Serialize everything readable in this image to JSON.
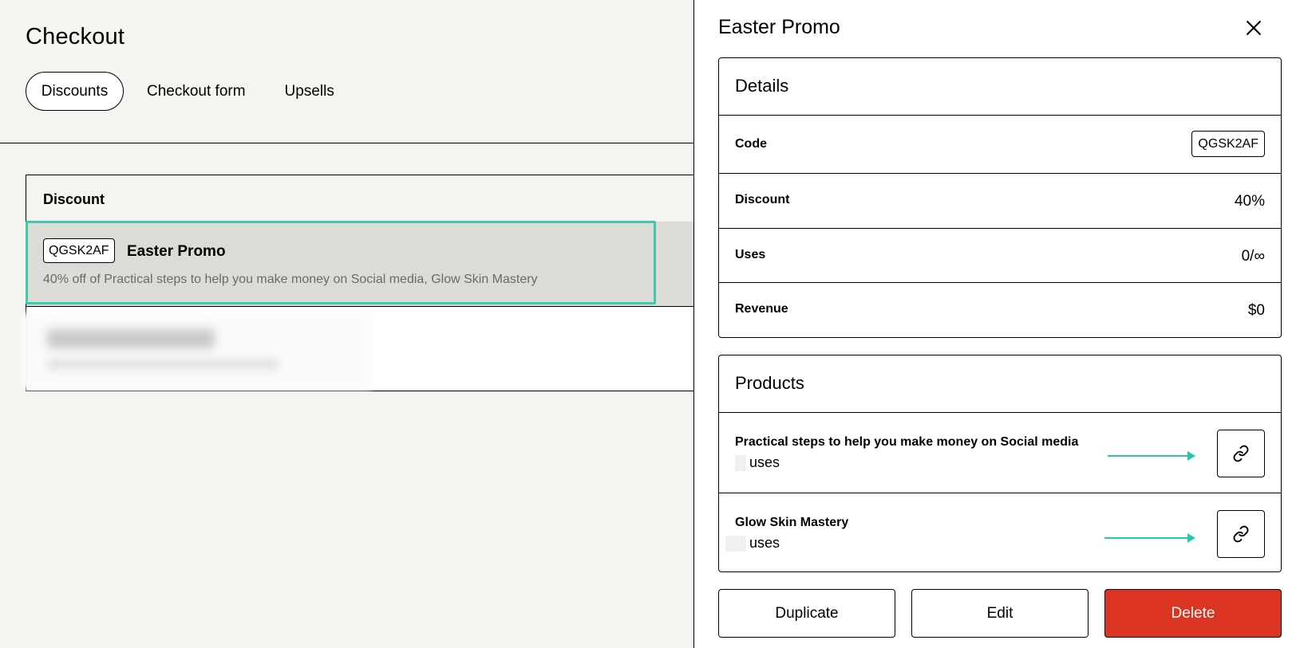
{
  "page": {
    "title": "Checkout",
    "tabs": [
      {
        "label": "Discounts",
        "active": true
      },
      {
        "label": "Checkout form",
        "active": false
      },
      {
        "label": "Upsells",
        "active": false
      }
    ]
  },
  "table": {
    "header": "Discount",
    "rows": [
      {
        "code": "QGSK2AF",
        "name": "Easter Promo",
        "description": "40% off of Practical steps to help you make money on Social media, Glow Skin Mastery",
        "selected": true
      }
    ]
  },
  "drawer": {
    "title": "Easter Promo",
    "details": {
      "heading": "Details",
      "code_label": "Code",
      "code_value": "QGSK2AF",
      "discount_label": "Discount",
      "discount_value": "40%",
      "uses_label": "Uses",
      "uses_value": "0/∞",
      "revenue_label": "Revenue",
      "revenue_value": "$0"
    },
    "products": {
      "heading": "Products",
      "items": [
        {
          "name": "Practical steps to help you make money on Social media",
          "uses_suffix": "uses"
        },
        {
          "name": "Glow Skin Mastery",
          "uses_suffix": "uses"
        }
      ]
    },
    "actions": {
      "duplicate": "Duplicate",
      "edit": "Edit",
      "delete": "Delete"
    }
  },
  "colors": {
    "accent": "#3ec9ab",
    "danger": "#dc3422",
    "selected_row": "#dcdcd6",
    "page_bg": "#f4f4f0"
  },
  "icons": {
    "close": "close-icon",
    "link": "link-icon"
  }
}
